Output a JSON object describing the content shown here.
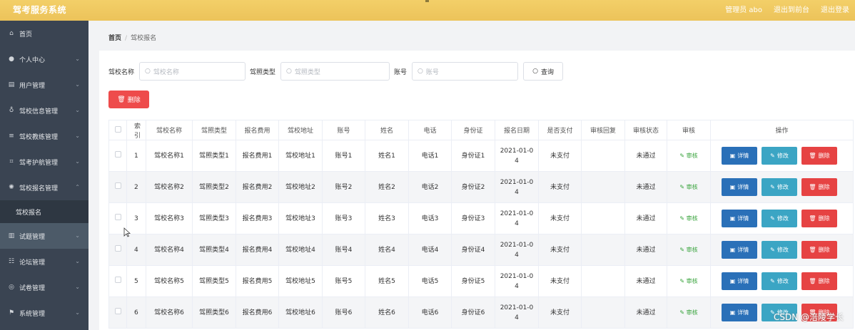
{
  "header": {
    "brand": "驾考服务系统",
    "admin": "管理员 abo",
    "back_front": "退出到前台",
    "logout": "退出登录"
  },
  "sidebar": {
    "items": [
      {
        "label": "首页",
        "icon": "home-icon"
      },
      {
        "label": "个人中心",
        "icon": "user-icon"
      },
      {
        "label": "用户管理",
        "icon": "list-icon"
      },
      {
        "label": "驾校信息管理",
        "icon": "mic-icon"
      },
      {
        "label": "驾校教练管理",
        "icon": "menu-icon"
      },
      {
        "label": "驾考护航管理",
        "icon": "crop-icon"
      },
      {
        "label": "驾校报名管理",
        "icon": "globe-icon"
      },
      {
        "label": "驾校报名",
        "icon": ""
      },
      {
        "label": "试题管理",
        "icon": "clipboard-icon"
      },
      {
        "label": "论坛管理",
        "icon": "sliders-icon"
      },
      {
        "label": "试卷管理",
        "icon": "compass-icon"
      },
      {
        "label": "系统管理",
        "icon": "flag-icon"
      }
    ]
  },
  "breadcrumb": {
    "home": "首页",
    "sep": "/",
    "current": "驾校报名"
  },
  "search": {
    "school_label": "驾校名称",
    "school_placeholder": "驾校名称",
    "license_label": "驾照类型",
    "license_placeholder": "驾照类型",
    "account_label": "账号",
    "account_placeholder": "账号",
    "query_label": "查询"
  },
  "toolbar": {
    "delete_label": "删除"
  },
  "table": {
    "headers": [
      "索引",
      "驾校名称",
      "驾照类型",
      "报名费用",
      "驾校地址",
      "账号",
      "姓名",
      "电话",
      "身份证",
      "报名日期",
      "是否支付",
      "审核回复",
      "审核状态",
      "审核",
      "操作"
    ],
    "rows": [
      {
        "idx": "1",
        "school": "驾校名称1",
        "license": "驾照类型1",
        "fee": "报名费用1",
        "addr": "驾校地址1",
        "acct": "账号1",
        "name": "姓名1",
        "phone": "电话1",
        "id": "身份证1",
        "date1": "2021-01-0",
        "date2": "4",
        "paid": "未支付",
        "reply": "",
        "status": "未通过",
        "audit": "审核"
      },
      {
        "idx": "2",
        "school": "驾校名称2",
        "license": "驾照类型2",
        "fee": "报名费用2",
        "addr": "驾校地址2",
        "acct": "账号2",
        "name": "姓名2",
        "phone": "电话2",
        "id": "身份证2",
        "date1": "2021-01-0",
        "date2": "4",
        "paid": "未支付",
        "reply": "",
        "status": "未通过",
        "audit": "审核"
      },
      {
        "idx": "3",
        "school": "驾校名称3",
        "license": "驾照类型3",
        "fee": "报名费用3",
        "addr": "驾校地址3",
        "acct": "账号3",
        "name": "姓名3",
        "phone": "电话3",
        "id": "身份证3",
        "date1": "2021-01-0",
        "date2": "4",
        "paid": "未支付",
        "reply": "",
        "status": "未通过",
        "audit": "审核"
      },
      {
        "idx": "4",
        "school": "驾校名称4",
        "license": "驾照类型4",
        "fee": "报名费用4",
        "addr": "驾校地址4",
        "acct": "账号4",
        "name": "姓名4",
        "phone": "电话4",
        "id": "身份证4",
        "date1": "2021-01-0",
        "date2": "4",
        "paid": "未支付",
        "reply": "",
        "status": "未通过",
        "audit": "审核"
      },
      {
        "idx": "5",
        "school": "驾校名称5",
        "license": "驾照类型5",
        "fee": "报名费用5",
        "addr": "驾校地址5",
        "acct": "账号5",
        "name": "姓名5",
        "phone": "电话5",
        "id": "身份证5",
        "date1": "2021-01-0",
        "date2": "4",
        "paid": "未支付",
        "reply": "",
        "status": "未通过",
        "audit": "审核"
      },
      {
        "idx": "6",
        "school": "驾校名称6",
        "license": "驾照类型6",
        "fee": "报名费用6",
        "addr": "驾校地址6",
        "acct": "账号6",
        "name": "姓名6",
        "phone": "电话6",
        "id": "身份证6",
        "date1": "2021-01-0",
        "date2": "4",
        "paid": "未支付",
        "reply": "",
        "status": "未通过",
        "audit": "审核"
      }
    ],
    "ops": {
      "detail": "详情",
      "edit": "修改",
      "delete": "删除"
    }
  },
  "watermark": "CSDN @涪陵学长",
  "colors": {
    "header": "#ecc35a",
    "sidebar": "#3a4452",
    "detail": "#2a70b8",
    "edit": "#3ba5c4",
    "danger": "#e64343",
    "audit_link": "#37a33b"
  }
}
